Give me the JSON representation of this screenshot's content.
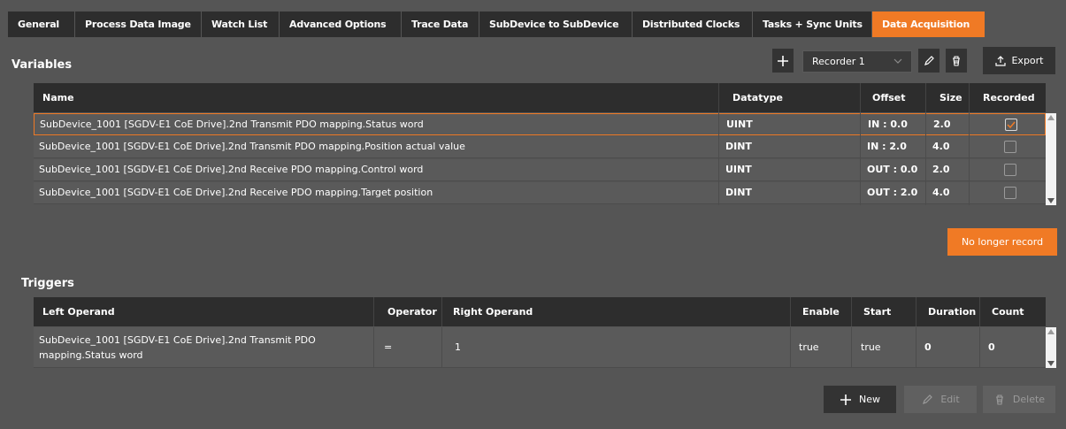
{
  "tabs": [
    {
      "label": "General",
      "active": false
    },
    {
      "label": "Process Data Image",
      "active": false
    },
    {
      "label": "Watch List",
      "active": false
    },
    {
      "label": "Advanced Options",
      "active": false
    },
    {
      "label": "Trace Data",
      "active": false
    },
    {
      "label": "SubDevice to SubDevice",
      "active": false
    },
    {
      "label": "Distributed Clocks",
      "active": false
    },
    {
      "label": "Tasks + Sync Units",
      "active": false
    },
    {
      "label": "Data Acquisition",
      "active": true
    }
  ],
  "variables": {
    "title": "Variables",
    "toolbar": {
      "recorder_value": "Recorder 1",
      "export_label": "Export"
    },
    "columns": [
      "Name",
      "Datatype",
      "Offset",
      "Size",
      "Recorded"
    ],
    "rows": [
      {
        "name": "SubDevice_1001 [SGDV-E1 CoE Drive].2nd Transmit PDO mapping.Status word",
        "datatype": "UINT",
        "offset": "IN : 0.0",
        "size": "2.0",
        "recorded": true
      },
      {
        "name": "SubDevice_1001 [SGDV-E1 CoE Drive].2nd Transmit PDO mapping.Position actual value",
        "datatype": "DINT",
        "offset": "IN : 2.0",
        "size": "4.0",
        "recorded": false
      },
      {
        "name": "SubDevice_1001 [SGDV-E1 CoE Drive].2nd Receive PDO mapping.Control word",
        "datatype": "UINT",
        "offset": "OUT : 0.0",
        "size": "2.0",
        "recorded": false
      },
      {
        "name": "SubDevice_1001 [SGDV-E1 CoE Drive].2nd Receive PDO mapping.Target position",
        "datatype": "DINT",
        "offset": "OUT : 2.0",
        "size": "4.0",
        "recorded": false
      }
    ],
    "no_longer_record_label": "No longer record"
  },
  "triggers": {
    "title": "Triggers",
    "columns": [
      "Left Operand",
      "Operator",
      "Right Operand",
      "Enable",
      "Start",
      "Duration",
      "Count"
    ],
    "rows": [
      {
        "left_line1": "SubDevice_1001 [SGDV-E1 CoE Drive].2nd Transmit PDO",
        "left_line2": "mapping.Status word",
        "operator": "=",
        "right": "1",
        "enable": "true",
        "start": "true",
        "duration": "0",
        "count": "0"
      }
    ],
    "buttons": {
      "new": "New",
      "edit": "Edit",
      "delete": "Delete"
    }
  },
  "colors": {
    "accent": "#f07a25",
    "header_bg": "#2d2d2d",
    "background": "#555555"
  }
}
